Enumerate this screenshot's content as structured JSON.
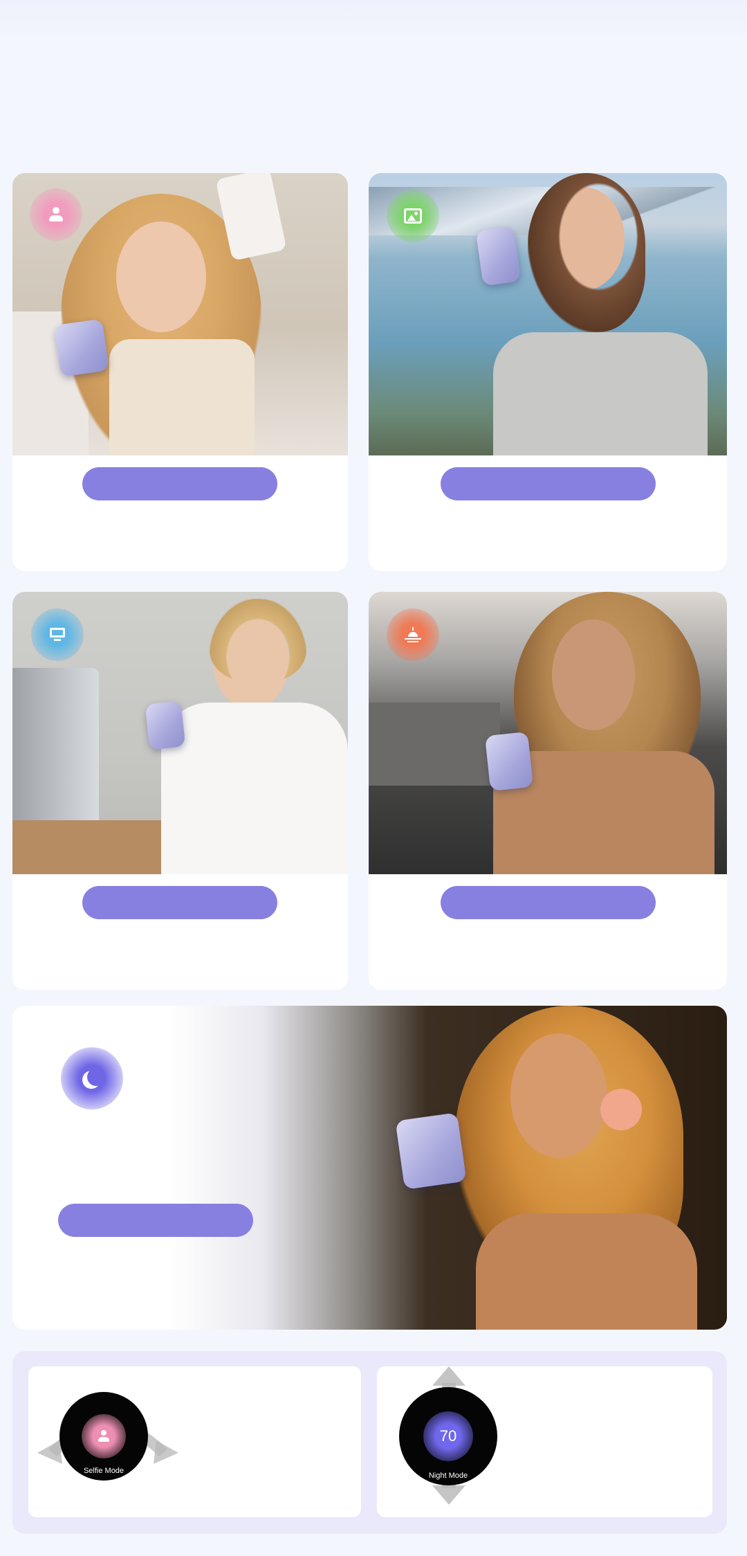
{
  "cards": [
    {
      "mode": "selfie",
      "icon": "person-icon",
      "accent": "#ec8fb2"
    },
    {
      "mode": "outdoor",
      "icon": "landscape-icon",
      "accent": "#7ed36b"
    },
    {
      "mode": "office",
      "icon": "monitor-icon",
      "accent": "#5fb7e6"
    },
    {
      "mode": "daylight",
      "icon": "sunrise-icon",
      "accent": "#f07a55"
    },
    {
      "mode": "night",
      "icon": "moon-icon",
      "accent": "#6f66e6"
    }
  ],
  "controls": {
    "selfie_knob": {
      "label": "Selfie Mode",
      "icon": "person-icon",
      "accent": "#ec8fb2"
    },
    "night_knob": {
      "label": "Night Mode",
      "value": "70",
      "accent": "#7068ec"
    }
  },
  "colors": {
    "pill": "#8880e0",
    "background": "#f4f6fe",
    "panel": "#e9e9fb"
  }
}
